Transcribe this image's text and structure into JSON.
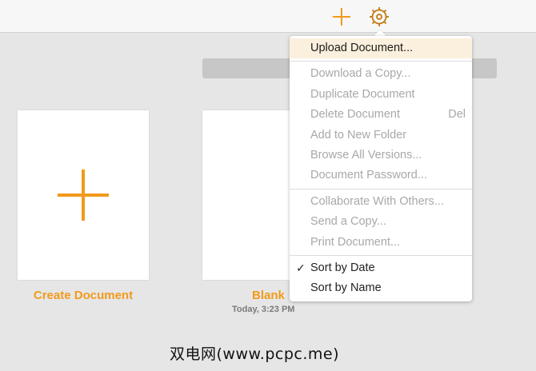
{
  "toolbar": {
    "add_icon": "plus-icon",
    "settings_icon": "gear-icon",
    "accent_color": "#f29a1b"
  },
  "documents": [
    {
      "label": "Create Document",
      "date": ""
    },
    {
      "label": "Blank",
      "date": "Today, 3:23 PM"
    }
  ],
  "menu": {
    "groups": [
      [
        {
          "label": "Upload Document...",
          "enabled": true,
          "highlighted": true
        }
      ],
      [
        {
          "label": "Download a Copy...",
          "enabled": false
        },
        {
          "label": "Duplicate Document",
          "enabled": false
        },
        {
          "label": "Delete Document",
          "enabled": false,
          "shortcut": "Del"
        },
        {
          "label": "Add to New Folder",
          "enabled": false
        },
        {
          "label": "Browse All Versions...",
          "enabled": false
        },
        {
          "label": "Document Password...",
          "enabled": false
        }
      ],
      [
        {
          "label": "Collaborate With Others...",
          "enabled": false
        },
        {
          "label": "Send a Copy...",
          "enabled": false
        },
        {
          "label": "Print Document...",
          "enabled": false
        }
      ],
      [
        {
          "label": "Sort by Date",
          "enabled": true,
          "checked": true
        },
        {
          "label": "Sort by Name",
          "enabled": true
        }
      ]
    ]
  },
  "watermark": "双电网(www.pcpc.me)"
}
